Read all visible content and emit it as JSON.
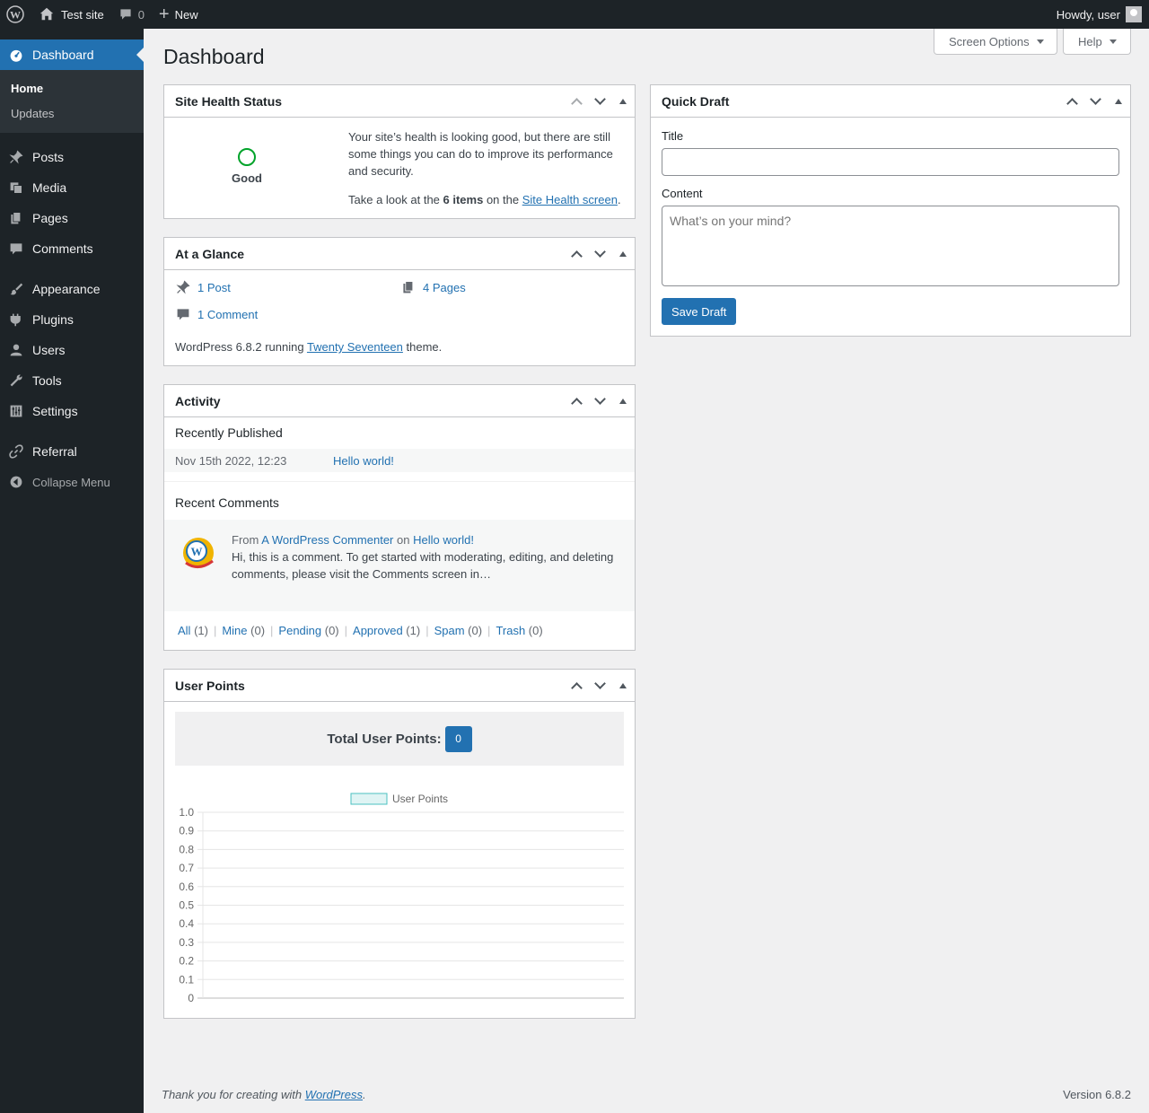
{
  "adminbar": {
    "site_name": "Test site",
    "comments_count": "0",
    "new_label": "New",
    "howdy": "Howdy, user"
  },
  "sidebar": {
    "dashboard": "Dashboard",
    "sub_home": "Home",
    "sub_updates": "Updates",
    "items": [
      "Posts",
      "Media",
      "Pages",
      "Comments",
      "Appearance",
      "Plugins",
      "Users",
      "Tools",
      "Settings",
      "Referral"
    ],
    "collapse": "Collapse Menu"
  },
  "header": {
    "title": "Dashboard",
    "screen_options": "Screen Options",
    "help": "Help"
  },
  "site_health": {
    "title": "Site Health Status",
    "status": "Good",
    "text1": "Your site’s health is looking good, but there are still some things you can do to improve its performance and security.",
    "text2_pre": "Take a look at the ",
    "text2_count": "6 items",
    "text2_mid": " on the ",
    "text2_link": "Site Health screen",
    "text2_post": "."
  },
  "glance": {
    "title": "At a Glance",
    "posts": "1 Post",
    "pages": "4 Pages",
    "comments": "1 Comment",
    "version_pre": "WordPress 6.8.2 running ",
    "theme_link": "Twenty Seventeen",
    "version_post": " theme."
  },
  "activity": {
    "title": "Activity",
    "recently_published": "Recently Published",
    "pub_date": "Nov 15th 2022, 12:23",
    "pub_title": "Hello world!",
    "recent_comments": "Recent Comments",
    "from": "From",
    "commenter": "A WordPress Commenter",
    "on": "on",
    "comment_post": "Hello world!",
    "comment_excerpt": "Hi, this is a comment. To get started with moderating, editing, and deleting comments, please visit the Comments screen in…",
    "filters": [
      {
        "label": "All",
        "count": "(1)"
      },
      {
        "label": "Mine",
        "count": "(0)"
      },
      {
        "label": "Pending",
        "count": "(0)"
      },
      {
        "label": "Approved",
        "count": "(1)"
      },
      {
        "label": "Spam",
        "count": "(0)"
      },
      {
        "label": "Trash",
        "count": "(0)"
      }
    ]
  },
  "user_points": {
    "title": "User Points",
    "total_label": "Total User Points:",
    "total_value": "0"
  },
  "quick_draft": {
    "title": "Quick Draft",
    "title_label": "Title",
    "title_value": "",
    "content_label": "Content",
    "content_placeholder": "What’s on your mind?",
    "save": "Save Draft"
  },
  "footer": {
    "thanks_pre": "Thank you for creating with ",
    "thanks_link": "WordPress",
    "thanks_post": ".",
    "version": "Version 6.8.2"
  },
  "chart_data": {
    "type": "line",
    "series": [
      {
        "name": "User Points",
        "values": []
      }
    ],
    "yticks": [
      "1.0",
      "0.9",
      "0.8",
      "0.7",
      "0.6",
      "0.5",
      "0.4",
      "0.3",
      "0.2",
      "0.1",
      "0"
    ],
    "ylim": [
      0,
      1
    ],
    "grid": true,
    "legend": "top-center",
    "series_color": "#4bc0c0"
  },
  "colors": {
    "accent": "#2271b1",
    "adminbar": "#1d2327",
    "good": "#00a32a"
  }
}
